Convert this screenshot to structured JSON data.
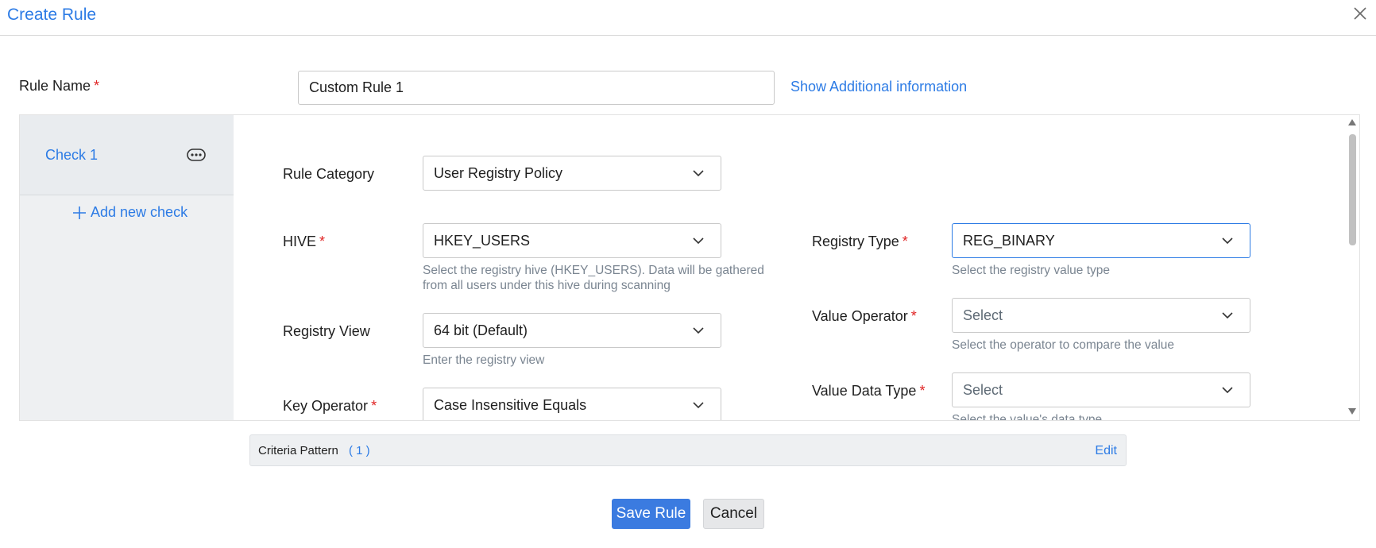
{
  "dialog": {
    "title": "Create Rule"
  },
  "rule_name": {
    "label": "Rule Name",
    "required": "*",
    "value": "Custom Rule 1"
  },
  "additional_info_link": "Show Additional information",
  "sidebar": {
    "check_label": "Check 1",
    "add_check_label": "Add new check",
    "add_icon": "plus-icon",
    "more_icon": "more-options-icon"
  },
  "form": {
    "rule_category": {
      "label": "Rule Category",
      "value": "User Registry Policy"
    },
    "hive": {
      "label": "HIVE",
      "required": "*",
      "value": "HKEY_USERS",
      "help_line1": "Select the registry hive (HKEY_USERS). Data will be gathered",
      "help_line2": "from all users under this hive during scanning"
    },
    "registry_view": {
      "label": "Registry View",
      "value": "64 bit (Default)",
      "help": "Enter the registry view"
    },
    "key_operator": {
      "label": "Key Operator",
      "required": "*",
      "value": "Case Insensitive Equals"
    },
    "registry_type": {
      "label": "Registry Type",
      "required": "*",
      "value": "REG_BINARY",
      "help": "Select the registry value type"
    },
    "value_operator": {
      "label": "Value Operator",
      "required": "*",
      "placeholder": "Select",
      "help": "Select the operator to compare the value"
    },
    "value_data_type": {
      "label": "Value Data Type",
      "required": "*",
      "placeholder": "Select",
      "help": "Select the value's data type"
    }
  },
  "criteria": {
    "label": "Criteria Pattern",
    "count": "( 1 )",
    "edit_label": "Edit"
  },
  "buttons": {
    "save": "Save Rule",
    "cancel": "Cancel"
  },
  "colors": {
    "accent": "#2c7be5",
    "required": "#e02424",
    "primary_button": "#3b7be0"
  }
}
